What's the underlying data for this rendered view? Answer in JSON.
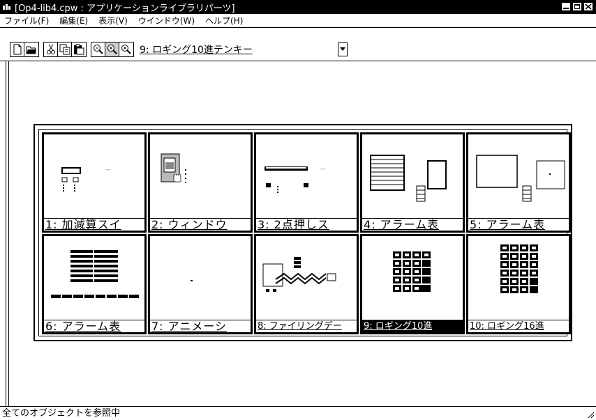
{
  "window": {
    "title": "[Op4-lib4.cpw : アプリケーションライブラリパーツ]",
    "icon": "app-icon"
  },
  "menu": [
    {
      "label": "ファイル(F)"
    },
    {
      "label": "編集(E)"
    },
    {
      "label": "表示(V)"
    },
    {
      "label": "ウインドウ(W)"
    },
    {
      "label": "ヘルプ(H)"
    }
  ],
  "toolbar": {
    "buttons": [
      "new-file-icon",
      "open-file-icon",
      "cut-icon",
      "copy-icon",
      "paste-icon",
      "zoom-out-icon",
      "zoom-icon",
      "zoom-in-icon"
    ],
    "dropdown_value": "9: ロギング10進テンキー"
  },
  "parts": [
    {
      "label": "1: 加減算スイ"
    },
    {
      "label": "2: ウィンドウ"
    },
    {
      "label": "3: 2点押しス"
    },
    {
      "label": "4: アラーム表"
    },
    {
      "label": "5: アラーム表"
    },
    {
      "label": "6: アラーム表"
    },
    {
      "label": "7: アニメーシ"
    },
    {
      "label": "8: ファイリングデー"
    },
    {
      "label": "9: ロギング10進"
    },
    {
      "label": "10: ロギング16進"
    }
  ],
  "status": {
    "text": "全てのオブジェクトを参照中"
  }
}
